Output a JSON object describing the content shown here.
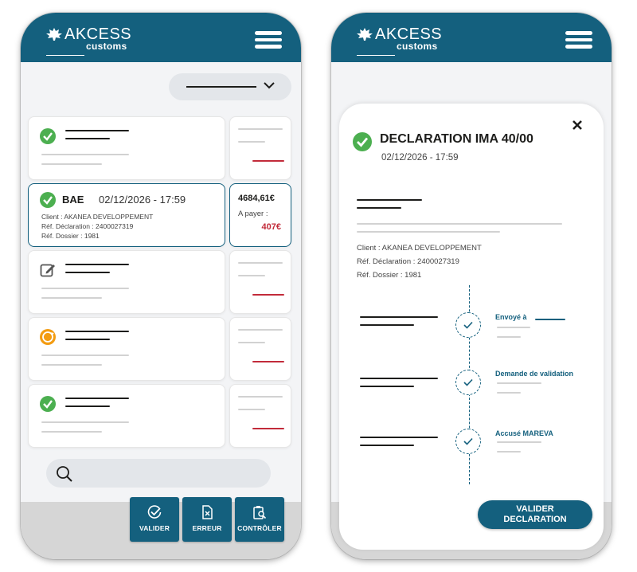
{
  "brand": {
    "name": "AKCESS",
    "sub": "customs",
    "color": "#14607e"
  },
  "colors": {
    "accent": "#14607e",
    "success": "#4caf50",
    "danger": "#c22b3a",
    "warning": "#f39c12"
  },
  "list": {
    "selected": {
      "type": "BAE",
      "date": "02/12/2026 - 17:59",
      "client": "Client : AKANEA DEVELOPPEMENT",
      "ref_declaration": "Réf. Déclaration : 2400027319",
      "ref_dossier": "Réf. Dossier : 1981",
      "amount": "4684,61€",
      "pay_label": "A payer :",
      "pay_value": "407€"
    },
    "row_status_icons": [
      "check-circle-icon",
      "check-circle-icon",
      "edit-icon",
      "sync-icon",
      "check-circle-icon"
    ]
  },
  "actions": [
    {
      "label": "VALIDER",
      "icon": "validate-icon"
    },
    {
      "label": "ERREUR",
      "icon": "error-file-icon"
    },
    {
      "label": "CONTRÔLER",
      "icon": "control-icon"
    }
  ],
  "detail": {
    "title": "DECLARATION IMA 40/00",
    "date": "02/12/2026 - 17:59",
    "client": "Client : AKANEA DEVELOPPEMENT",
    "ref_declaration": "Réf. Déclaration : 2400027319",
    "ref_dossier": "Réf. Dossier : 1981",
    "timeline": [
      {
        "label": "Envoyé à"
      },
      {
        "label": "Demande de validation"
      },
      {
        "label": "Accusé MAREVA"
      }
    ],
    "validate_line1": "VALIDER",
    "validate_line2": "DECLARATION"
  }
}
